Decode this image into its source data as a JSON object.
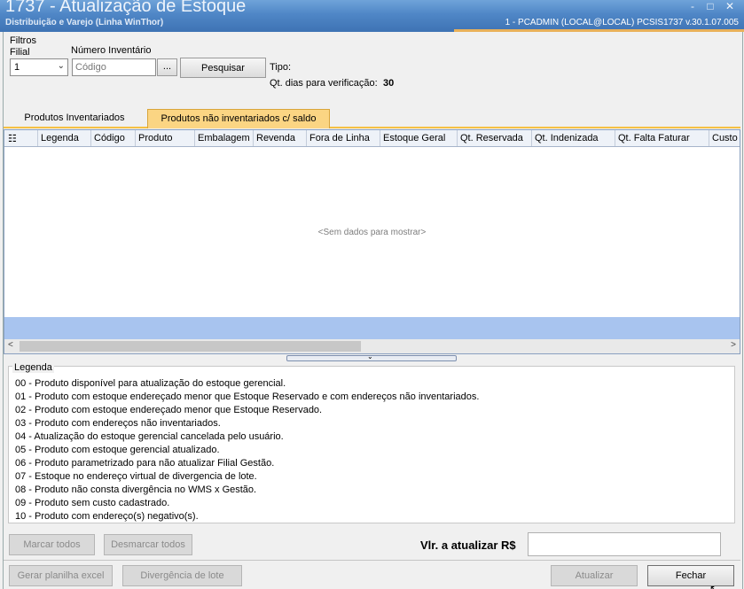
{
  "titlebar": {
    "title": "1737 - Atualização de Estoque",
    "subtitle": "Distribuição e Varejo (Linha WinThor)",
    "connection": "1 - PCADMIN (LOCAL@LOCAL)   PCSIS1737  v.30.1.07.005",
    "controls": [
      "-",
      "□",
      "✕"
    ]
  },
  "filters": {
    "group_label": "Filtros",
    "filial_label": "Filial",
    "filial_value": "1",
    "inventario_label": "Número Inventário",
    "inventario_placeholder": "Código",
    "browse_label": "...",
    "search_label": "Pesquisar",
    "tipo_label": "Tipo:",
    "dias_label": "Qt. dias para verificação:",
    "dias_value": "30"
  },
  "tabs": [
    {
      "label": "Produtos  Inventariados",
      "active": false
    },
    {
      "label": "Produtos não inventariados c/ saldo",
      "active": true
    }
  ],
  "grid": {
    "columns": [
      "Legenda",
      "Código",
      "Produto",
      "Embalagem",
      "Revenda",
      "Fora de Linha",
      "Estoque Geral",
      "Qt. Reservada",
      "Qt. Indenizada",
      "Qt. Falta Faturar",
      "Custo"
    ],
    "empty_text": "<Sem dados para mostrar>"
  },
  "legend": {
    "title": "Legenda",
    "items": [
      "00 - Produto disponível para atualização do estoque gerencial.",
      "01 - Produto com estoque endereçado menor que Estoque Reservado e  com endereços não inventariados.",
      "02 - Produto com estoque endereçado menor que Estoque Reservado.",
      "03 - Produto com endereços não inventariados.",
      "04 - Atualização do estoque gerencial cancelada pelo usuário.",
      "05 - Produto com estoque gerencial atualizado.",
      "06 - Produto parametrizado para não atualizar Filial Gestão.",
      "07 - Estoque no endereço virtual de divergencia de lote.",
      "08 - Produto não consta divergência no WMS x Gestão.",
      "09 - Produto sem custo cadastrado.",
      "10 - Produto com endereço(s) negativo(s)."
    ]
  },
  "actions": {
    "marcar_todos": "Marcar todos",
    "desmarcar_todos": "Desmarcar todos",
    "vlr_label": "Vlr. a atualizar R$",
    "vlr_value": "",
    "gerar_planilha": "Gerar planilha excel",
    "divergencia_lote": "Divergência de lote",
    "atualizar": "Atualizar",
    "fechar": "Fechar"
  }
}
